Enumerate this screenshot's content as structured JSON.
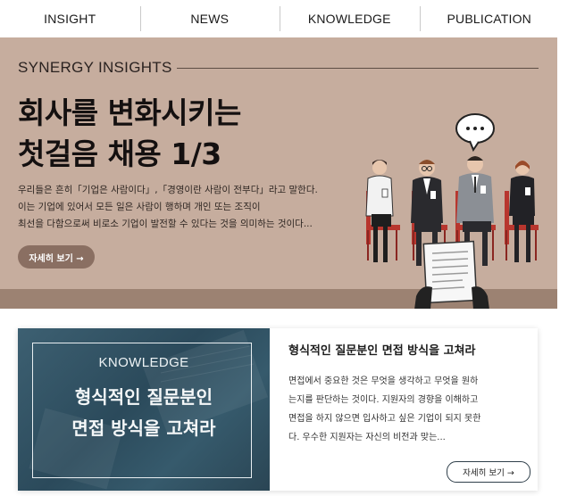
{
  "nav": {
    "items": [
      {
        "label": "INSIGHT"
      },
      {
        "label": "NEWS"
      },
      {
        "label": "KNOWLEDGE"
      },
      {
        "label": "PUBLICATION"
      }
    ]
  },
  "hero": {
    "eyebrow": "SYNERGY INSIGHTS",
    "title_line1": "회사를 변화시키는",
    "title_line2": "첫걸음 채용 1/3",
    "desc_line1": "우리들은 흔히「기업은 사람이다」,「경영이란 사람이 전부다」라고 말한다.",
    "desc_line2": "이는 기업에 있어서 모든 일은  사람이 행하며 개인 또는 조직이",
    "desc_line3": "최선을 다함으로써 비로소 기업이 발전할 수 있다는 것을 의미하는 것이다...",
    "button_label": "자세히 보기 →",
    "colors": {
      "background": "#c6ad9e",
      "floor": "#9c8272",
      "button": "#8a6f62"
    }
  },
  "card": {
    "image_tag": "KNOWLEDGE",
    "image_title_line1": "형식적인 질문분인",
    "image_title_line2": "면접 방식을 고쳐라",
    "title": "형식적인 질문분인 면접 방식을 고쳐라",
    "desc_line1": "면접에서 중요한 것은 무엇을 생각하고 무엇을 원하",
    "desc_line2": "는지를 판단하는 것이다. 지원자의 경향을 이해하고",
    "desc_line3": "면접을 하지 않으면 입사하고 싶은 기업이 되지 못한",
    "desc_line4": "다. 우수한 지원자는 자신의 비전과 맞는...",
    "button_label": "자세히 보기 →",
    "colors": {
      "image": "#2f4f60"
    }
  },
  "illustration": {
    "icon": "interview-candidates-illustration",
    "speech_bubble": "..."
  }
}
